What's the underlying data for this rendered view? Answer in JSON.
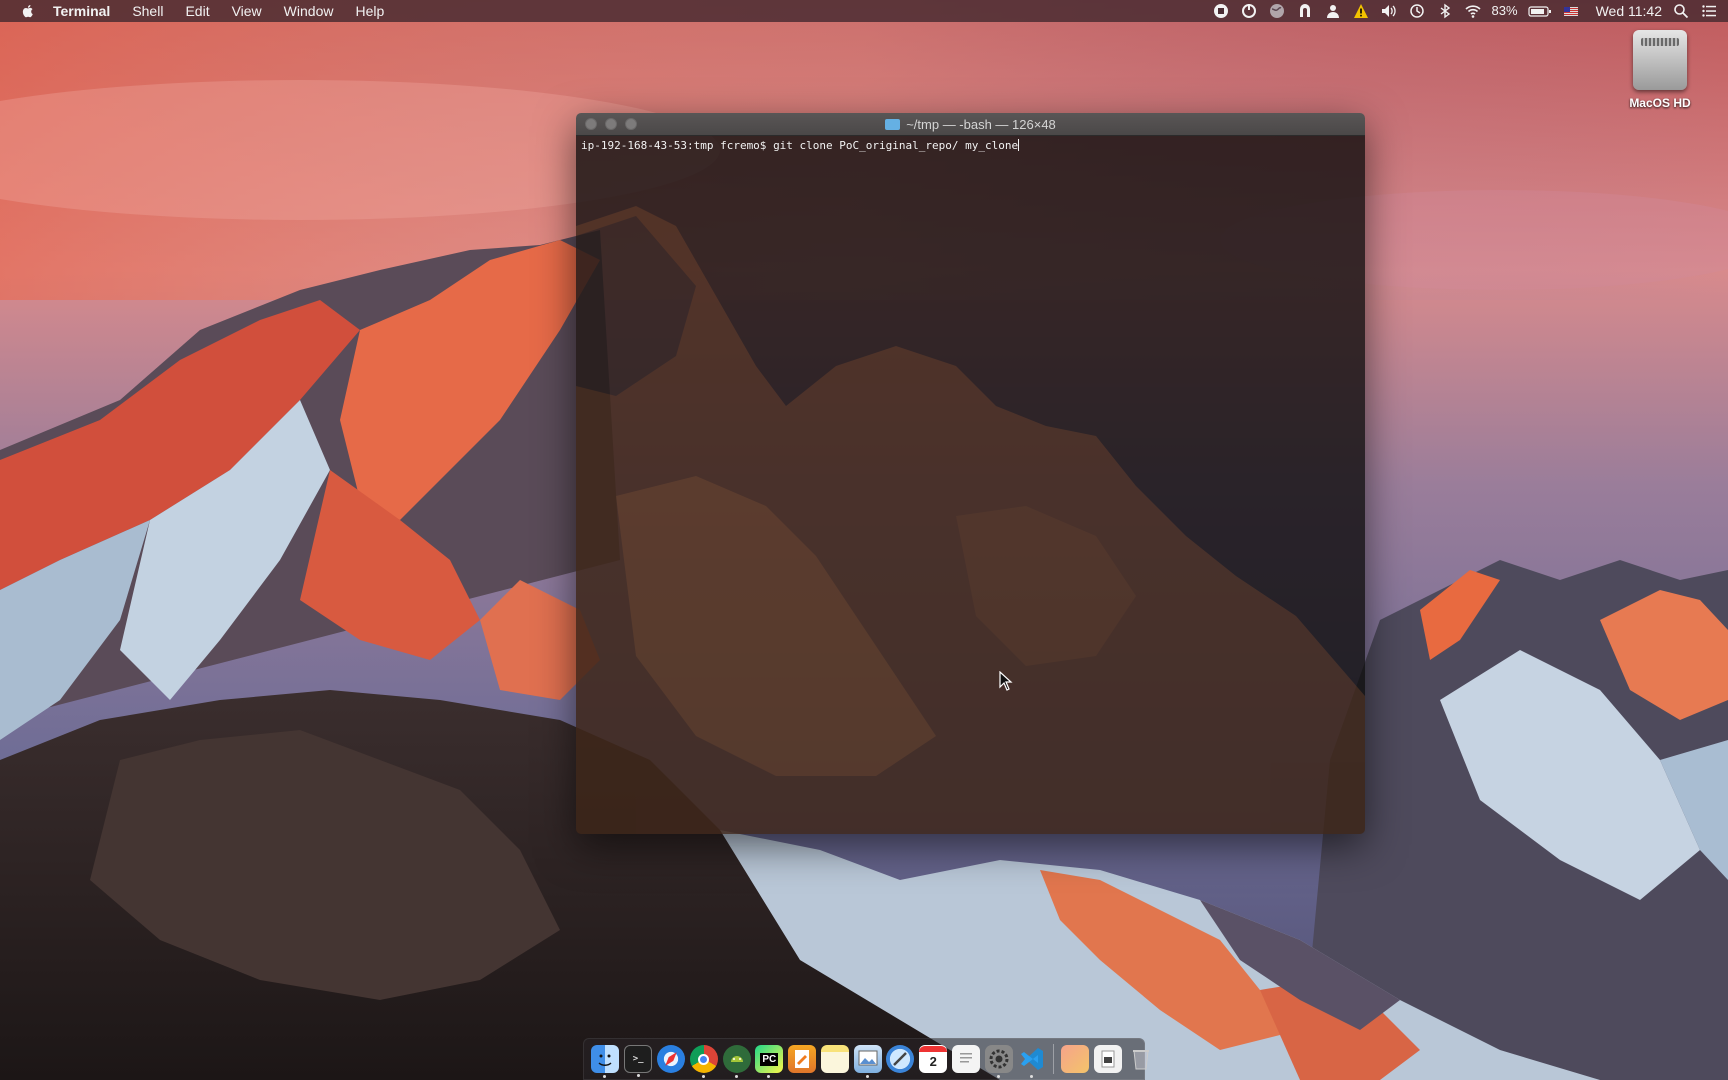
{
  "menubar": {
    "app_name": "Terminal",
    "menus": [
      "Shell",
      "Edit",
      "View",
      "Window",
      "Help"
    ],
    "battery_percent": "83%",
    "clock": "Wed 11:42",
    "status_icons": [
      "stop-icon",
      "sync-icon",
      "globe-icon",
      "vpn-icon",
      "user-icon",
      "warning-icon",
      "volume-icon",
      "time-machine-icon",
      "bluetooth-icon",
      "wifi-icon",
      "battery-icon",
      "flag-icon",
      "spotlight-icon",
      "notification-center-icon"
    ]
  },
  "desktop": {
    "drive_label": "MacOS HD"
  },
  "terminal": {
    "title": "~/tmp — -bash — 126×48",
    "prompt": "ip-192-168-43-53:tmp fcremo$ ",
    "command": "git clone PoC_original_repo/ my_clone"
  },
  "dock": {
    "apps": [
      "Finder",
      "Terminal",
      "Safari",
      "Chrome",
      "Android Studio",
      "PyCharm",
      "Pages",
      "Notes",
      "Preview",
      "Xcode",
      "Calendar",
      "TextEdit",
      "System Preferences",
      "Visual Studio Code",
      "Photos",
      "Documents",
      "Trash"
    ],
    "calendar_day": "2",
    "pycharm_label": "PC"
  }
}
